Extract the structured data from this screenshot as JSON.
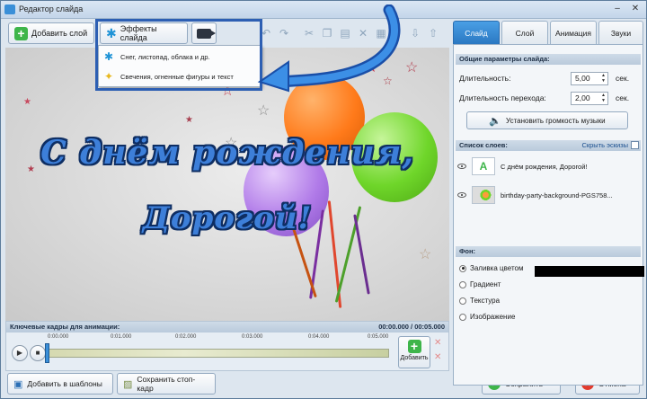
{
  "window": {
    "title": "Редактор слайда"
  },
  "toolbar": {
    "add_layer_label": "Добавить слой",
    "effects_label": "Эффекты слайда"
  },
  "effects_menu": {
    "items": [
      {
        "label": "Снег, листопад, облака и др.",
        "icon": "snowflake-icon"
      },
      {
        "label": "Свечения, огненные фигуры и текст",
        "icon": "glow-stars-icon"
      }
    ]
  },
  "canvas": {
    "greeting_line1": "С днём рождения,",
    "greeting_line2": "Дорогой!",
    "colors": {
      "text_fill": "#3d7fd9",
      "text_outline": "#0e2e63",
      "balloon_orange": "#ff7a1a",
      "balloon_green": "#6fd62a",
      "balloon_purple": "#b07ae8"
    }
  },
  "timeline": {
    "title": "Ключевые кадры для анимации:",
    "time_readout": "00:00.000 / 00:05.000",
    "ticks": [
      "0:00.000",
      "0:01.000",
      "0:02.000",
      "0:03.000",
      "0:04.000",
      "0:05.000"
    ],
    "add_key_label": "Добавить"
  },
  "bottom": {
    "add_to_templates_label": "Добавить в шаблоны",
    "save_frame_label": "Сохранить стоп-кадр",
    "save_label": "Сохранить",
    "cancel_label": "Отмена"
  },
  "panel": {
    "tabs": [
      "Слайд",
      "Слой",
      "Анимация",
      "Звуки"
    ],
    "active_tab": "Слайд",
    "general_header": "Общие параметры слайда:",
    "duration_label": "Длительность:",
    "duration_value": "5,00",
    "transition_label": "Длительность перехода:",
    "transition_value": "2,00",
    "unit": "сек.",
    "music_volume_label": "Установить громкость музыки",
    "layers_header": "Список слоев:",
    "hide_thumbs_label": "Скрыть эскизы",
    "layers": [
      {
        "name": "С днём рождения,  Дорогой!",
        "type": "text"
      },
      {
        "name": "birthday-party-background-PGS758...",
        "type": "image"
      }
    ],
    "background_header": "Фон:",
    "background_options": [
      "Заливка цветом",
      "Градиент",
      "Текстура",
      "Изображение"
    ],
    "background_selected": "Заливка цветом",
    "fill_color": "#000000"
  }
}
